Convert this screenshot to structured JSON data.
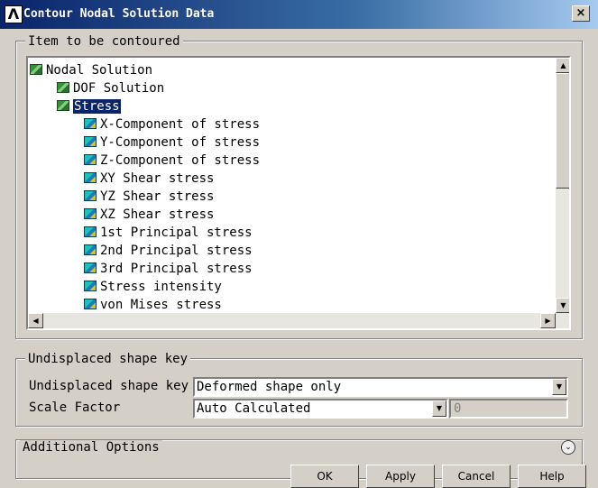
{
  "window": {
    "title": "Contour Nodal Solution Data",
    "logo": "Λ",
    "close_glyph": "×"
  },
  "item_group": {
    "label": "Item to be contoured",
    "tree": [
      {
        "label": "Nodal Solution",
        "icon": "folder-icon"
      },
      {
        "label": "DOF Solution",
        "icon": "folder-icon"
      },
      {
        "label": "Stress",
        "icon": "folder-icon",
        "selected": true
      },
      {
        "label": "X-Component of stress",
        "icon": "cube-icon"
      },
      {
        "label": "Y-Component of stress",
        "icon": "cube-icon"
      },
      {
        "label": "Z-Component of stress",
        "icon": "cube-icon"
      },
      {
        "label": "XY Shear stress",
        "icon": "cube-icon"
      },
      {
        "label": "YZ Shear stress",
        "icon": "cube-icon"
      },
      {
        "label": "XZ Shear stress",
        "icon": "cube-icon"
      },
      {
        "label": "1st Principal stress",
        "icon": "cube-icon"
      },
      {
        "label": "2nd Principal stress",
        "icon": "cube-icon"
      },
      {
        "label": "3rd Principal stress",
        "icon": "cube-icon"
      },
      {
        "label": "Stress intensity",
        "icon": "cube-icon"
      },
      {
        "label": "von Mises stress",
        "icon": "cube-icon"
      }
    ]
  },
  "shape_group": {
    "label": "Undisplaced shape key",
    "shape_key_label": "Undisplaced shape key",
    "shape_key_value": "Deformed shape only",
    "scale_factor_label": "Scale Factor",
    "scale_factor_value": "Auto Calculated",
    "scale_factor_number": "0"
  },
  "additional": {
    "label": "Additional Options"
  },
  "buttons": {
    "ok": "OK",
    "apply": "Apply",
    "cancel": "Cancel",
    "help": "Help"
  },
  "colors": {
    "titlebar": "#0a246a",
    "selection": "#0a246a",
    "face": "#d4d0c8"
  }
}
